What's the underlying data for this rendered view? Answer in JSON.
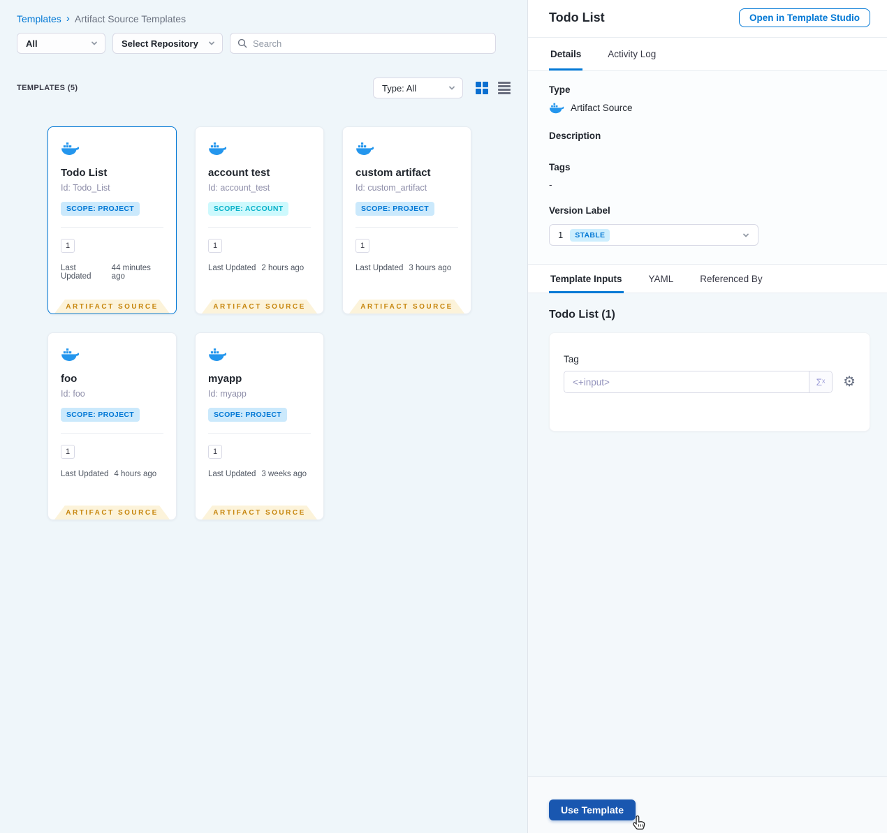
{
  "colors": {
    "primary_blue": "#0278d5",
    "docker_blue": "#2496ed",
    "use_template_blue": "#1957b0",
    "scope_project_bg": "#cbe9fc",
    "scope_account_bg": "#cdf9fd",
    "scope_account_text": "#0ab2c9",
    "ribbon_bg": "#fcf3da",
    "ribbon_text": "#c7860e"
  },
  "icons": {
    "search": "magnifier",
    "chevron_down": "chevron-down",
    "grid_view": "grid-2x2",
    "list_view": "list-lines",
    "docker": "docker-whale",
    "expression": "Σˣ",
    "gear": "⚙",
    "cursor": "pointer-hand"
  },
  "breadcrumb": {
    "parent": "Templates",
    "separator": "›",
    "current": "Artifact Source Templates"
  },
  "filters": {
    "scope_dropdown": "All",
    "repo_dropdown": "Select Repository",
    "search_placeholder": "Search"
  },
  "list_header": {
    "count_label": "TEMPLATES (5)",
    "type_filter": "Type: All"
  },
  "cards": [
    {
      "title": "Todo List",
      "id": "Id: Todo_List",
      "scope": "SCOPE: PROJECT",
      "scope_type": "project",
      "selected": "true",
      "version": "1",
      "updated_label": "Last Updated",
      "updated": "44 minutes ago",
      "badge": "ARTIFACT SOURCE"
    },
    {
      "title": "account test",
      "id": "Id: account_test",
      "scope": "SCOPE: ACCOUNT",
      "scope_type": "account",
      "selected": "false",
      "version": "1",
      "updated_label": "Last Updated",
      "updated": "2 hours ago",
      "badge": "ARTIFACT SOURCE"
    },
    {
      "title": "custom artifact",
      "id": "Id: custom_artifact",
      "scope": "SCOPE: PROJECT",
      "scope_type": "project",
      "selected": "false",
      "version": "1",
      "updated_label": "Last Updated",
      "updated": "3 hours ago",
      "badge": "ARTIFACT SOURCE"
    },
    {
      "title": "foo",
      "id": "Id: foo",
      "scope": "SCOPE: PROJECT",
      "scope_type": "project",
      "selected": "false",
      "version": "1",
      "updated_label": "Last Updated",
      "updated": "4 hours ago",
      "badge": "ARTIFACT SOURCE"
    },
    {
      "title": "myapp",
      "id": "Id: myapp",
      "scope": "SCOPE: PROJECT",
      "scope_type": "project",
      "selected": "false",
      "version": "1",
      "updated_label": "Last Updated",
      "updated": "3 weeks ago",
      "badge": "ARTIFACT SOURCE"
    }
  ],
  "panel": {
    "title": "Todo List",
    "open_studio_button": "Open in Template Studio",
    "tabs": {
      "details": "Details",
      "activity_log": "Activity Log"
    },
    "details": {
      "type_label": "Type",
      "type_value": "Artifact Source",
      "description_label": "Description",
      "tags_label": "Tags",
      "tags_value": "-",
      "version_label": "Version Label",
      "version_value": "1",
      "version_badge": "STABLE"
    },
    "inner_tabs": {
      "template_inputs": "Template Inputs",
      "yaml": "YAML",
      "referenced_by": "Referenced By"
    },
    "inputs": {
      "heading": "Todo List (1)",
      "tag_label": "Tag",
      "tag_value": "<+input>"
    },
    "use_template_button": "Use Template"
  }
}
